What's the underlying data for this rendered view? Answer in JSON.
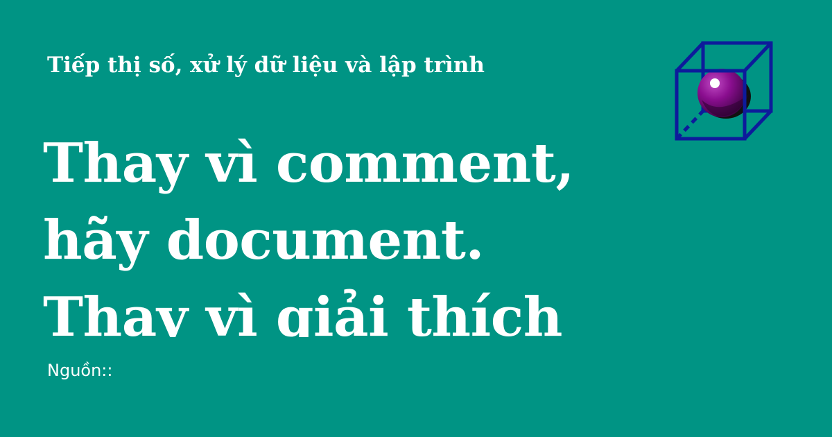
{
  "header": {
    "tagline": "Tiếp thị số, xử lý dữ liệu và lập trình"
  },
  "headline": {
    "lines": [
      "Thay vì comment,",
      "hãy document.",
      "Thay vì giải thích"
    ]
  },
  "footer": {
    "source_label": "Nguồn::"
  },
  "logo": {
    "icon": "cube-sphere-icon"
  },
  "colors": {
    "background": "#009484",
    "text": "#ffffff",
    "cube_stroke": "#0d1b9b",
    "sphere": "#8a0e8f"
  }
}
